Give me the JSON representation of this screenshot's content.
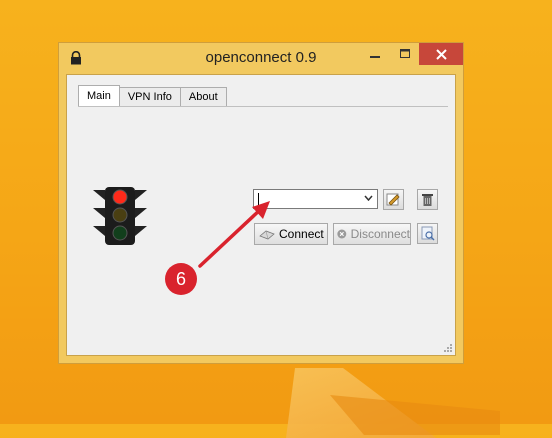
{
  "window": {
    "title": "openconnect 0.9"
  },
  "tabs": [
    {
      "label": "Main",
      "active": true
    },
    {
      "label": "VPN Info",
      "active": false
    },
    {
      "label": "About",
      "active": false
    }
  ],
  "server_combo": {
    "value": ""
  },
  "buttons": {
    "connect_label": "Connect",
    "disconnect_label": "Disconnect"
  },
  "annotation": {
    "badge_number": "6",
    "color": "#d9232d"
  },
  "icons": {
    "title": "lock-icon",
    "status": "traffic-light-icon",
    "edit": "edit-icon",
    "delete": "trash-icon",
    "log": "search-icon"
  },
  "colors": {
    "desktop": "#f5a616",
    "window_frame": "#f2c95f",
    "close_button": "#c7473a",
    "traffic_light_red": "#ff2a1a"
  }
}
